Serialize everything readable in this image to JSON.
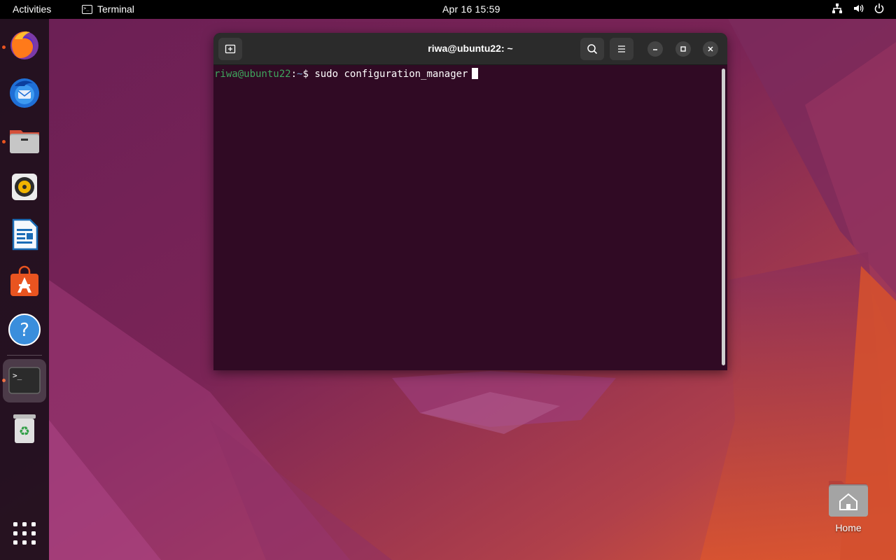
{
  "topbar": {
    "activities": "Activities",
    "app_name": "Terminal",
    "app_icon": "terminal-icon",
    "clock": "Apr 16  15:59",
    "tray": [
      "network-icon",
      "volume-icon",
      "power-icon"
    ]
  },
  "dock": {
    "items": [
      {
        "name": "firefox",
        "icon": "firefox-icon",
        "running": true
      },
      {
        "name": "thunderbird",
        "icon": "thunderbird-icon",
        "running": false
      },
      {
        "name": "files",
        "icon": "files-icon",
        "running": true
      },
      {
        "name": "rhythmbox",
        "icon": "rhythmbox-icon",
        "running": false
      },
      {
        "name": "libreoffice-writer",
        "icon": "writer-icon",
        "running": false
      },
      {
        "name": "ubuntu-software",
        "icon": "software-icon",
        "running": false
      },
      {
        "name": "help",
        "icon": "help-icon",
        "running": false
      },
      {
        "name": "terminal",
        "icon": "terminal-icon",
        "running": true,
        "active": true
      },
      {
        "name": "trash",
        "icon": "trash-icon",
        "running": false
      }
    ],
    "show_apps_icon": "apps-grid-icon"
  },
  "terminal": {
    "title": "riwa@ubuntu22: ~",
    "prompt_user": "riwa@ubuntu22",
    "prompt_sep": ":",
    "prompt_path": "~",
    "prompt_symbol": "$",
    "command": "sudo configuration_manager",
    "buttons": [
      "new-tab-icon",
      "search-icon",
      "menu-icon",
      "minimize-icon",
      "maximize-icon",
      "close-icon"
    ]
  },
  "desktop": {
    "home_label": "Home"
  },
  "colors": {
    "terminal_bg": "#300a24",
    "prompt_green": "#3fa55d",
    "accent_orange": "#e95420"
  }
}
